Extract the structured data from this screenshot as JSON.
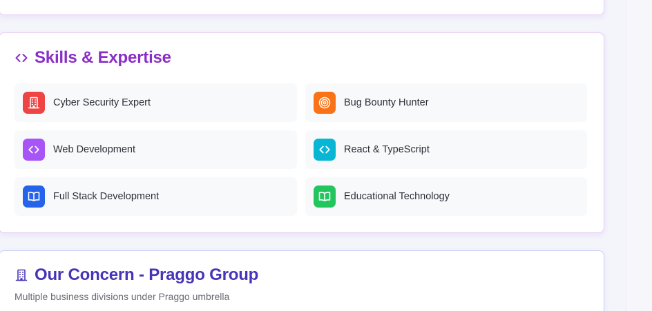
{
  "skills_section": {
    "title": "Skills & Expertise",
    "title_color": "#8a2fc6",
    "items": [
      {
        "label": "Cyber Security Expert",
        "icon": "building-icon",
        "color": "#ef4444"
      },
      {
        "label": "Bug Bounty Hunter",
        "icon": "target-icon",
        "color": "#f97316"
      },
      {
        "label": "Web Development",
        "icon": "code-icon",
        "color": "#a855f7"
      },
      {
        "label": "React & TypeScript",
        "icon": "code-icon",
        "color": "#06b6d4"
      },
      {
        "label": "Full Stack Development",
        "icon": "book-icon",
        "color": "#2563eb"
      },
      {
        "label": "Educational Technology",
        "icon": "book-icon",
        "color": "#22c55e"
      }
    ]
  },
  "concern_section": {
    "title": "Our Concern - Praggo Group",
    "subtitle": "Multiple business divisions under Praggo umbrella",
    "title_color": "#4634b9"
  }
}
